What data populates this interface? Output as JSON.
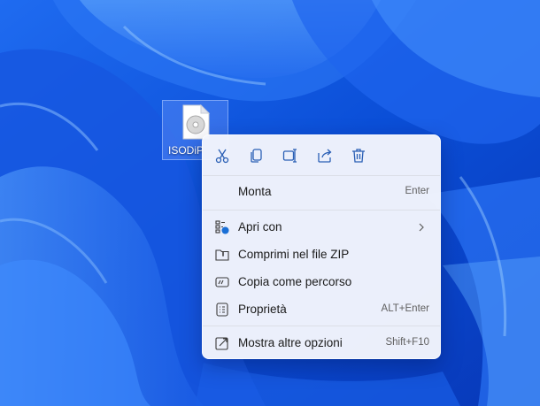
{
  "desktop": {
    "icon_label": "ISODiP"
  },
  "context_menu": {
    "toolbar": [
      {
        "name": "cut-icon"
      },
      {
        "name": "copy-icon"
      },
      {
        "name": "rename-icon"
      },
      {
        "name": "share-icon"
      },
      {
        "name": "delete-icon"
      }
    ],
    "items": [
      {
        "label": "Monta",
        "shortcut": "Enter"
      },
      {
        "label": "Apri con",
        "icon": "open-with-icon",
        "submenu": true
      },
      {
        "label": "Comprimi nel file ZIP",
        "icon": "zip-folder-icon"
      },
      {
        "label": "Copia come percorso",
        "icon": "copy-path-icon"
      },
      {
        "label": "Proprietà",
        "icon": "properties-icon",
        "shortcut": "ALT+Enter"
      },
      {
        "label": "Mostra altre opzioni",
        "icon": "more-options-icon",
        "shortcut": "Shift+F10"
      }
    ]
  },
  "colors": {
    "accent": "#1a6fd6",
    "wallpaper_base": "#0a4fd6"
  }
}
